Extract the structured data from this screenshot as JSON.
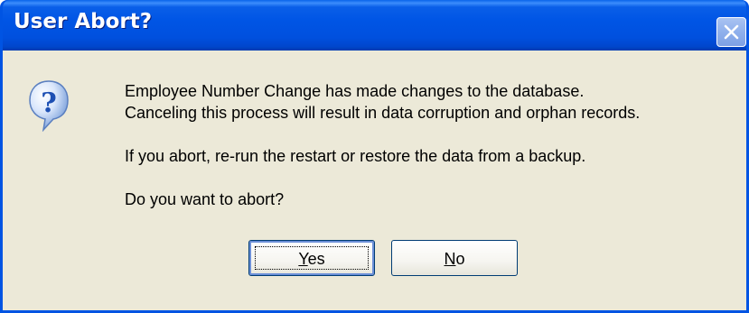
{
  "window": {
    "title": "User Abort?",
    "close_icon": "close-icon"
  },
  "dialog": {
    "icon": "question-icon",
    "lines": [
      "Employee Number Change has made changes to the database.",
      "Canceling this process will result in data corruption and orphan records.",
      "If you abort, re-run the restart or restore the data from a backup.",
      "Do you want to abort?"
    ]
  },
  "buttons": {
    "yes_label": "Yes",
    "yes_accel": "Y",
    "yes_rest": "es",
    "no_label": "No",
    "no_accel": "N",
    "no_rest": "o"
  },
  "colors": {
    "titlebar": "#0054e3",
    "dialog_bg": "#ece9d8",
    "icon_blue": "#2f6fd8"
  }
}
